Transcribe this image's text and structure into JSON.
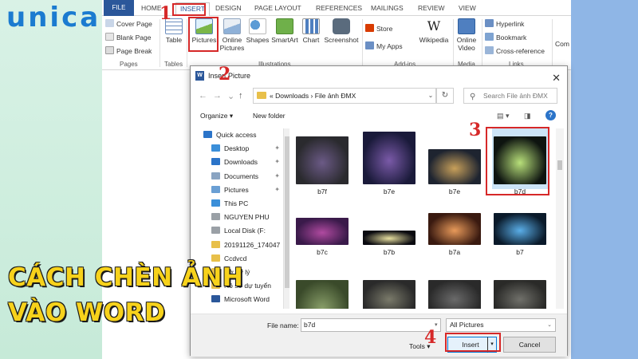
{
  "logo": {
    "text": "unica"
  },
  "headline": {
    "line1": "CÁCH CHÈN ẢNH",
    "line2": "VÀO WORD"
  },
  "ribbon": {
    "tabs": [
      "FILE",
      "HOME",
      "INSERT",
      "DESIGN",
      "PAGE LAYOUT",
      "REFERENCES",
      "MAILINGS",
      "REVIEW",
      "VIEW"
    ],
    "active_tab": "INSERT",
    "pages": {
      "items": [
        "Cover Page",
        "Blank Page",
        "Page Break"
      ],
      "label": "Pages"
    },
    "tables": {
      "button": "Table",
      "label": "Tables"
    },
    "illustrations": {
      "buttons": [
        "Pictures",
        "Online Pictures",
        "Shapes",
        "SmartArt",
        "Chart",
        "Screenshot"
      ],
      "label": "Illustrations"
    },
    "addins": {
      "items": [
        "Store",
        "My Apps"
      ],
      "wikipedia": "Wikipedia",
      "label": "Add-ins"
    },
    "media": {
      "button": "Online Video",
      "label": "Media"
    },
    "links": {
      "items": [
        "Hyperlink",
        "Bookmark",
        "Cross-reference"
      ],
      "label": "Links"
    },
    "comments": {
      "button": "Com"
    }
  },
  "steps": [
    "1",
    "2",
    "3",
    "4"
  ],
  "dialog": {
    "title": "Insert Picture",
    "close": "✕",
    "breadcrumb": {
      "prefix": "«",
      "parts": [
        "Downloads",
        "File ảnh ĐMX"
      ],
      "sep": "›"
    },
    "search_placeholder": "Search File ảnh ĐMX",
    "organize": "Organize ▾",
    "new_folder": "New folder",
    "help": "?",
    "nav": [
      {
        "label": "Quick access",
        "icon": "star-icon",
        "color": "#2b74c9"
      },
      {
        "label": "Desktop",
        "icon": "desktop-icon",
        "color": "#3b8fd9"
      },
      {
        "label": "Downloads",
        "icon": "download-icon",
        "color": "#2b74c9"
      },
      {
        "label": "Documents",
        "icon": "document-icon",
        "color": "#8aa4c2"
      },
      {
        "label": "Pictures",
        "icon": "picture-icon",
        "color": "#6a9fd4"
      },
      {
        "label": "This PC",
        "icon": "computer-icon",
        "color": "#3b8fd9"
      },
      {
        "label": "NGUYEN PHU",
        "icon": "drive-icon",
        "color": "#9aa0a6"
      },
      {
        "label": "Local Disk (F:",
        "icon": "drive-icon",
        "color": "#9aa0a6"
      },
      {
        "label": "20191126_174047",
        "icon": "folder-icon",
        "color": "#e8c04a"
      },
      {
        "label": "Ccdvcd",
        "icon": "folder-icon",
        "color": "#e8c04a"
      },
      {
        "label": "Cơ sở lý",
        "icon": "folder-icon",
        "color": "#e8c04a"
      },
      {
        "label": "Hồ sơ dự tuyển",
        "icon": "folder-icon",
        "color": "#e8c04a"
      },
      {
        "label": "Microsoft Word",
        "icon": "word-icon",
        "color": "#2b579a"
      }
    ],
    "files": [
      {
        "name": "b7f",
        "colors": [
          "#2a2a2e",
          "#6b5a86"
        ]
      },
      {
        "name": "b7e",
        "colors": [
          "#1a1a3a",
          "#7a5aa8"
        ]
      },
      {
        "name": "b7e",
        "colors": [
          "#1e2430",
          "#c8a05a"
        ]
      },
      {
        "name": "b7d",
        "colors": [
          "#0e1410",
          "#b8e07a"
        ]
      },
      {
        "name": "b7c",
        "colors": [
          "#3a1a4a",
          "#b04aa0"
        ]
      },
      {
        "name": "b7b",
        "colors": [
          "#0a0a10",
          "#e8e0a0"
        ]
      },
      {
        "name": "b7a",
        "colors": [
          "#3a1a10",
          "#e89a5a"
        ]
      },
      {
        "name": "b7",
        "colors": [
          "#0a1a2a",
          "#5aaee8"
        ]
      },
      {
        "name": "",
        "colors": [
          "#3a4a2a",
          "#8aa06a"
        ]
      },
      {
        "name": "",
        "colors": [
          "#2a2a2a",
          "#7a7a6a"
        ]
      },
      {
        "name": "",
        "colors": [
          "#2a2a2a",
          "#6a6a6a"
        ]
      },
      {
        "name": "",
        "colors": [
          "#2a2a28",
          "#70706a"
        ]
      }
    ],
    "selected_file": "b7d",
    "file_name_label": "File name:",
    "file_name_value": "b7d",
    "file_type": "All Pictures",
    "tools": "Tools",
    "insert": "Insert",
    "cancel": "Cancel"
  },
  "colors": {
    "accent": "#2b579a",
    "highlight": "#d62828",
    "headline": "#f7d21b",
    "logo": "#1b7bd0"
  }
}
